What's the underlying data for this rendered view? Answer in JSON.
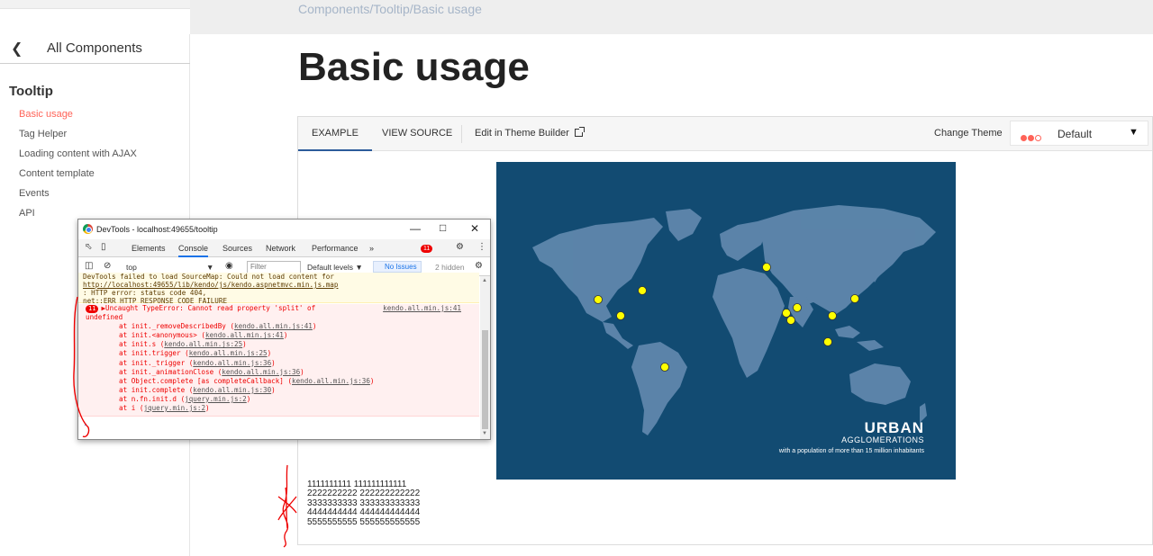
{
  "breadcrumb": {
    "part1": "Components",
    "part2": "Tooltip",
    "part3": "Basic usage"
  },
  "sidebar": {
    "back_label": "All Components",
    "section_title": "Tooltip",
    "items": [
      {
        "label": "Basic usage",
        "active": true
      },
      {
        "label": "Tag Helper"
      },
      {
        "label": "Loading content with AJAX"
      },
      {
        "label": "Content template"
      },
      {
        "label": "Events"
      },
      {
        "label": "API"
      }
    ]
  },
  "page_title": "Basic usage",
  "example": {
    "tabs": [
      "EXAMPLE",
      "VIEW SOURCE"
    ],
    "theme_builder": "Edit in Theme Builder",
    "change_theme": "Change Theme",
    "theme_value": "Default",
    "theme_colors": [
      "#ff6358",
      "#ff6358",
      "#ffffff"
    ],
    "map": {
      "title": "URBAN",
      "subtitle": "AGGLOMERATIONS",
      "caption": "with a population of more than 15 million inhabitants",
      "background": "#124b72",
      "marker_color": "#ffff00"
    },
    "lines": [
      "1111111111 111111111111",
      "2222222222 222222222222",
      "3333333333 333333333333",
      "4444444444 444444444444",
      "5555555555 555555555555"
    ]
  },
  "devtools": {
    "window_title": "DevTools - localhost:49655/tooltip",
    "tabs": [
      "Elements",
      "Console",
      "Sources",
      "Network",
      "Performance",
      "»"
    ],
    "error_count": "11",
    "context": "top",
    "filter_placeholder": "Filter",
    "levels": "Default levels ▼",
    "issues": "No Issues",
    "hidden": "2 hidden",
    "warning": {
      "line1": "DevTools failed to load SourceMap: Could not load content for ",
      "link": "http://localhost:49655/lib/kendo/js/kendo.aspnetmvc.min.js.map",
      "line2": ": HTTP error: status code 404,",
      "line3": "net::ERR_HTTP_RESPONSE_CODE_FAILURE"
    },
    "error": {
      "count": "11",
      "message": "▶Uncaught TypeError: Cannot read property 'split' of",
      "message2": "undefined",
      "location": "kendo.all.min.js:41",
      "stack": [
        {
          "fn": "at init._removeDescribedBy (",
          "loc": "kendo.all.min.js:41",
          "end": ")"
        },
        {
          "fn": "at init.<anonymous> (",
          "loc": "kendo.all.min.js:41",
          "end": ")"
        },
        {
          "fn": "at init.s (",
          "loc": "kendo.all.min.js:25",
          "end": ")"
        },
        {
          "fn": "at init.trigger (",
          "loc": "kendo.all.min.js:25",
          "end": ")"
        },
        {
          "fn": "at init._trigger (",
          "loc": "kendo.all.min.js:36",
          "end": ")"
        },
        {
          "fn": "at init._animationClose (",
          "loc": "kendo.all.min.js:36",
          "end": ")"
        },
        {
          "fn": "at Object.complete [as completeCallback] (",
          "loc": "kendo.all.min.js:36",
          "end": ")"
        },
        {
          "fn": "at init.complete (",
          "loc": "kendo.all.min.js:30",
          "end": ")"
        },
        {
          "fn": "at n.fn.init.d (",
          "loc": "jquery.min.js:2",
          "end": ")"
        },
        {
          "fn": "at i (",
          "loc": "jquery.min.js:2",
          "end": ")"
        }
      ]
    },
    "prompt": "›"
  }
}
